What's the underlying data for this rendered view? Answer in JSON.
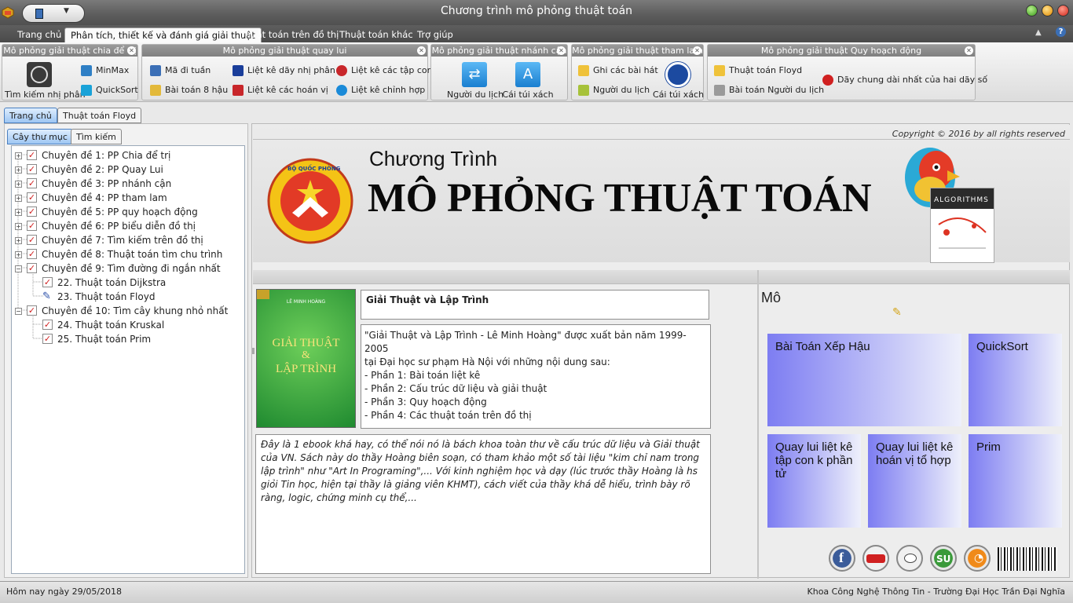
{
  "window": {
    "title": "Chương trình mô phỏng thuật toán"
  },
  "ribbon_tabs": [
    "Trang chủ",
    "Phân tích, thiết kế và đánh giá giải thuật",
    "Thuật toán trên đồ thị",
    "Thuật toán khác",
    "Trợ giúp"
  ],
  "groups": {
    "chia": {
      "title": "Mô phỏng giải thuật chia để trị",
      "big": "Tìm kiếm nhị phân",
      "minmax": "MinMax",
      "quicksort": "QuickSort"
    },
    "quaylui": {
      "title": "Mô phỏng giải thuật quay lui",
      "ma": "Mã đi tuần",
      "hau": "Bài toán 8 hậu",
      "daynp": "Liệt kê dãy nhị phân",
      "hoanvi": "Liệt kê các hoán vị",
      "tapcon": "Liệt kê các tập con",
      "chinhhop": "Liệt kê chỉnh hợp"
    },
    "nhanhcan": {
      "title": "Mô phỏng giải thuật nhánh cận",
      "nguoi": "Người du lịch",
      "tui": "Cái túi xách"
    },
    "thamlam": {
      "title": "Mô phỏng giải thuật tham lam",
      "baihat": "Ghi các bài hát",
      "nguoi": "Người du lịch",
      "tui": "Cái túi xách"
    },
    "qhd": {
      "title": "Mô phỏng giải thuật Quy hoạch động",
      "floyd": "Thuật toán Floyd",
      "nguoi": "Bài toán Người du lịch",
      "dayso": "Dãy chung dài nhất của hai dãy số"
    }
  },
  "doc_tabs": [
    "Trang chủ",
    "Thuật toán Floyd"
  ],
  "left_tabs": [
    "Cây thư mục",
    "Tìm kiếm"
  ],
  "tree": [
    "Chuyên đề 1: PP Chia để trị",
    "Chuyên đề 2: PP Quay Lui",
    "Chuyên đề 3: PP nhánh cận",
    "Chuyên đề 4: PP tham lam",
    "Chuyên đề 5: PP quy hoạch động",
    "Chuyên đề 6: PP biểu diễn đồ thị",
    "Chuyên đề 7: Tìm kiếm trên đồ thị",
    "Chuyên đề 8: Thuật toán tìm chu trình",
    "Chuyên đề 9: Tìm đường đi ngắn nhất",
    "22. Thuật toán Dijkstra",
    "23. Thuật toán Floyd",
    "Chuyên đề 10: Tìm cây khung nhỏ nhất",
    "24. Thuật toán Kruskal",
    "25. Thuật toán Prim"
  ],
  "banner": {
    "copyright": "Copyright © 2016 by all rights reserved",
    "line1": "Chương Trình",
    "line2": "MÔ PHỎNG THUẬT TOÁN",
    "logo_top": "BỘ QUỐC PHÒNG",
    "book_title": "ALGORITHMS"
  },
  "book": {
    "cover_title1": "GIẢI THUẬT",
    "cover_amp": "&",
    "cover_title2": "LẬP TRÌNH",
    "cover_author": "LÊ MINH HOÀNG",
    "title": "Giải Thuật và Lập Trình",
    "desc": [
      "\"Giải Thuật và Lập Trình - Lê Minh Hoàng\" được xuất bản năm 1999-2005",
      "tại Đại học sư phạm Hà Nội với những nội dung sau:",
      "- Phần 1: Bài toán liệt kê",
      "- Phần 2: Cấu trúc dữ liệu và giải thuật",
      "- Phần 3: Quy hoạch động",
      "- Phần 4: Các thuật toán trên đồ thị"
    ],
    "review": "Đây là 1 ebook khá hay, có thể nói nó là bách khoa toàn thư về cấu trúc dữ liệu và Giải thuật của VN. Sách này do thầy Hoàng biên soạn, có tham khảo một số tài liệu \"kim chỉ nam trong lập trình\" như \"Art In Programing\",... Với kinh nghiệm học và dạy (lúc trước thầy Hoàng là hs giỏi Tin học, hiện tại thầy là giảng viên KHMT), cách viết của thầy khá dễ hiểu, trình bày rõ ràng, logic, chứng minh cụ thể,..."
  },
  "tiles": {
    "heading": "Mô",
    "t1": "Bài Toán Xếp Hậu",
    "t2": "QuickSort",
    "t3": "Quay lui liệt kê tập con k phần tử",
    "t4": "Quay lui liệt kê hoán vị tổ hợp",
    "t5": "Prim"
  },
  "status": {
    "date": "Hôm nay ngày 29/05/2018",
    "org": "Khoa Công Nghệ Thông Tin - Trường Đại Học Trần Đại Nghĩa"
  },
  "colors": {
    "tile_start": "#7d7df2",
    "accent_blue": "#3b6fb6",
    "check_red": "#d02020"
  }
}
